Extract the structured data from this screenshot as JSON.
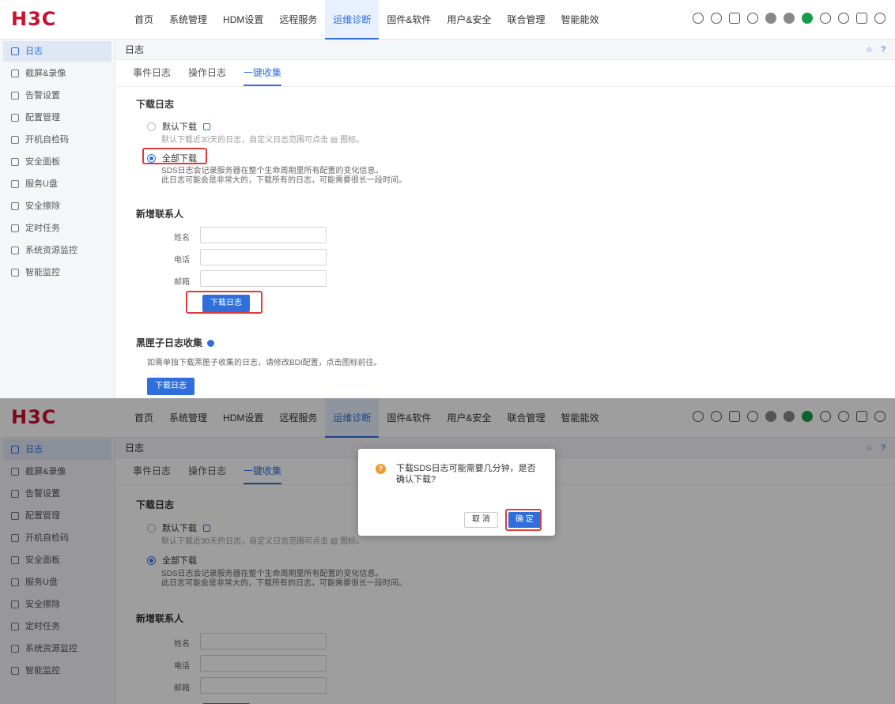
{
  "brand": {
    "logo": "H3C",
    "logo_color": "#c8102e"
  },
  "nav": {
    "items": [
      "首页",
      "系统管理",
      "HDM设置",
      "远程服务",
      "运维诊断",
      "固件&软件",
      "用户&安全",
      "联合管理",
      "智能能效"
    ],
    "active_index": 4
  },
  "topbar_icons": [
    "search-icon",
    "refresh-icon",
    "document-icon",
    "bell-icon",
    "circle-icon",
    "circle-icon",
    "power-icon",
    "globe-icon",
    "palette-icon",
    "lock-icon",
    "user-icon"
  ],
  "sidebar": {
    "items": [
      {
        "label": "日志",
        "icon": "log-icon"
      },
      {
        "label": "截屏&录像",
        "icon": "screenshot-icon"
      },
      {
        "label": "告警设置",
        "icon": "alarm-icon"
      },
      {
        "label": "配置管理",
        "icon": "config-icon"
      },
      {
        "label": "开机自检码",
        "icon": "post-code-icon"
      },
      {
        "label": "安全面板",
        "icon": "panel-icon"
      },
      {
        "label": "服务U盘",
        "icon": "usb-icon"
      },
      {
        "label": "安全擦除",
        "icon": "erase-icon"
      },
      {
        "label": "定时任务",
        "icon": "timer-icon"
      },
      {
        "label": "系统资源监控",
        "icon": "monitor-icon"
      },
      {
        "label": "智能监控",
        "icon": "smart-monitor-icon"
      }
    ],
    "active_index": 0
  },
  "page": {
    "title": "日志"
  },
  "tabs": [
    "事件日志",
    "操作日志",
    "一键收集"
  ],
  "active_tab": 2,
  "download_log": {
    "section_title": "下载日志",
    "option_default": "默认下载",
    "option_default_hint": "默认下载近30天的日志，自定义日志范围可点击 ▤ 图标。",
    "option_all": "全部下载",
    "option_all_hint_1": "SDS日志会记录服务器在整个生命周期里所有配置的变化信息。",
    "option_all_hint_2": "此日志可能会是非常大的，下载所有的日志，可能需要很长一段时间。",
    "selected": "all"
  },
  "contact": {
    "section_title": "新增联系人",
    "name_label": "姓名",
    "phone_label": "电话",
    "email_label": "邮箱",
    "name_value": "",
    "phone_value": "",
    "email_value": "",
    "download_button": "下载日志"
  },
  "blackbox": {
    "section_title": "黑匣子日志收集",
    "hint": "如需单独下载黑匣子收集的日志，请修改BDI配置，点击图标前往。",
    "download_button": "下载日志"
  },
  "dialog": {
    "message": "下载SDS日志可能需要几分钟，是否确认下载?",
    "cancel_label": "取 消",
    "ok_label": "确 定"
  },
  "colors": {
    "accent": "#2f6fdc",
    "highlight_box": "#e03b3b",
    "warning": "#f29b2c"
  }
}
